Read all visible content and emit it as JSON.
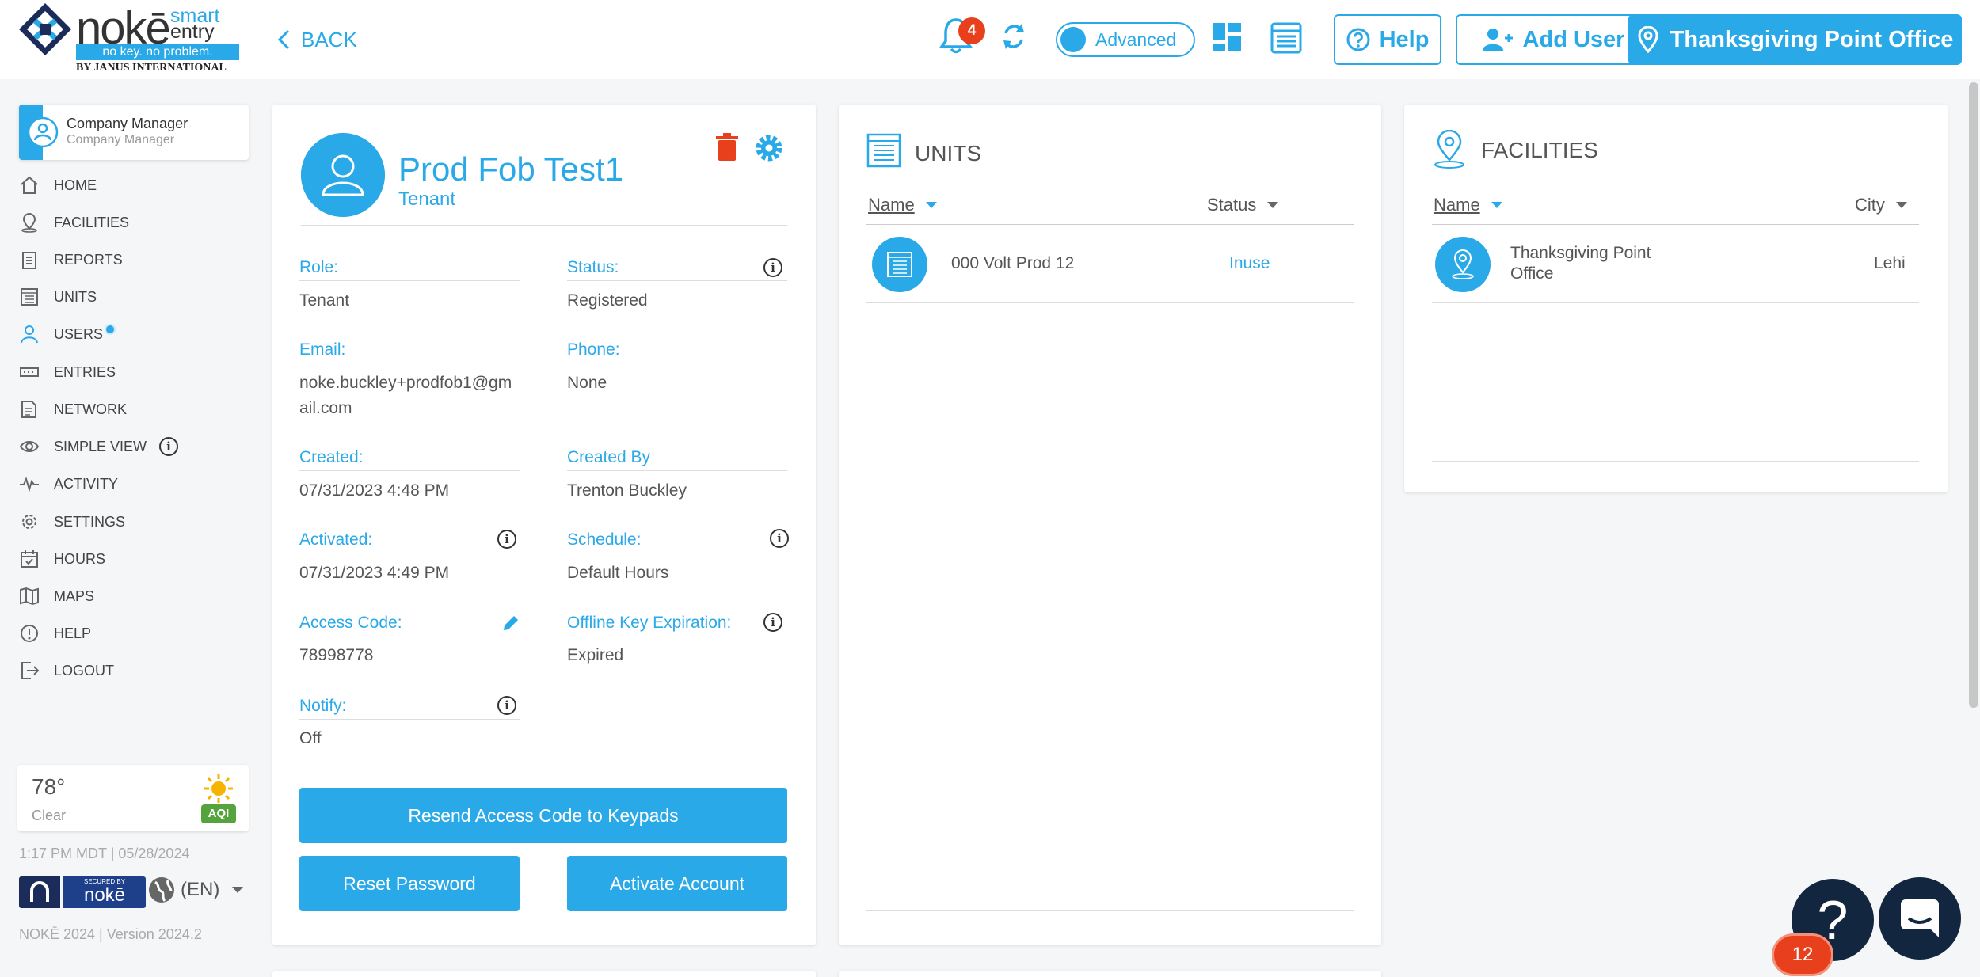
{
  "header": {
    "logo": {
      "word": "nokē",
      "smart": "smart",
      "entry": "entry",
      "tagline": "no key. no problem.",
      "by": "BY JANUS INTERNATIONAL"
    },
    "back_label": "BACK",
    "notification_count": "4",
    "mode_label": "Advanced",
    "help_label": "Help",
    "add_user_label": "Add User",
    "facility_label": "Thanksgiving Point Office"
  },
  "sidebar": {
    "user_name": "Company Manager",
    "user_role": "Company Manager",
    "items": [
      {
        "label": "HOME",
        "icon": "home-icon"
      },
      {
        "label": "FACILITIES",
        "icon": "location-icon"
      },
      {
        "label": "REPORTS",
        "icon": "clipboard-icon"
      },
      {
        "label": "UNITS",
        "icon": "units-icon"
      },
      {
        "label": "USERS",
        "icon": "user-icon"
      },
      {
        "label": "ENTRIES",
        "icon": "keypad-icon"
      },
      {
        "label": "NETWORK",
        "icon": "network-icon"
      },
      {
        "label": "SIMPLE VIEW",
        "icon": "eye-icon"
      },
      {
        "label": "ACTIVITY",
        "icon": "activity-icon"
      },
      {
        "label": "SETTINGS",
        "icon": "gear-icon"
      },
      {
        "label": "HOURS",
        "icon": "calendar-icon"
      },
      {
        "label": "MAPS",
        "icon": "map-icon"
      },
      {
        "label": "HELP",
        "icon": "help-icon"
      },
      {
        "label": "LOGOUT",
        "icon": "logout-icon"
      }
    ],
    "weather": {
      "temp": "78°",
      "condition": "Clear",
      "aqi": "AQI"
    },
    "timestamp": "1:17 PM MDT | 05/28/2024",
    "badge": {
      "secured_by": "SECURED BY",
      "brand": "nokē"
    },
    "language": "(EN)",
    "version": "NOKĒ 2024 | Version 2024.2"
  },
  "profile": {
    "name": "Prod Fob Test1",
    "role": "Tenant",
    "fields": {
      "role_label": "Role:",
      "role_value": "Tenant",
      "status_label": "Status:",
      "status_value": "Registered",
      "email_label": "Email:",
      "email_value_1": "noke.buckley+prodfob1@gm",
      "email_value_2": "ail.com",
      "phone_label": "Phone:",
      "phone_value": "None",
      "created_label": "Created:",
      "created_value": "07/31/2023 4:48 PM",
      "created_by_label": "Created By",
      "created_by_value": "Trenton Buckley",
      "activated_label": "Activated:",
      "activated_value": "07/31/2023 4:49 PM",
      "schedule_label": "Schedule:",
      "schedule_value": "Default Hours",
      "access_code_label": "Access Code:",
      "access_code_value": "78998778",
      "offline_label": "Offline Key Expiration:",
      "offline_value": "Expired",
      "notify_label": "Notify:",
      "notify_value": "Off"
    },
    "buttons": {
      "resend": "Resend Access Code to Keypads",
      "reset": "Reset Password",
      "activate": "Activate Account"
    }
  },
  "units": {
    "title": "UNITS",
    "col_name": "Name",
    "col_status": "Status",
    "rows": [
      {
        "name": "000 Volt Prod 12",
        "status": "Inuse"
      }
    ]
  },
  "facilities": {
    "title": "FACILITIES",
    "col_name": "Name",
    "col_city": "City",
    "rows": [
      {
        "name_1": "Thanksgiving Point",
        "name_2": "Office",
        "city": "Lehi"
      }
    ]
  },
  "widgets": {
    "help_fab": "?",
    "badge_count": "12"
  },
  "colors": {
    "accent": "#2aa9e8",
    "danger": "#e8401c",
    "dark": "#12263f"
  }
}
